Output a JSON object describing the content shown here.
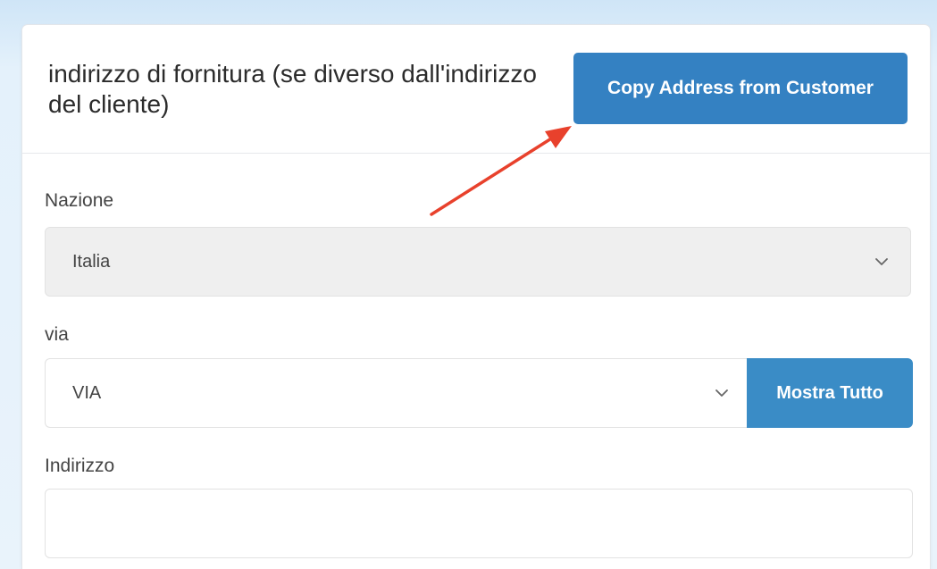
{
  "header": {
    "title": "indirizzo di fornitura (se diverso dall'indirizzo del cliente)",
    "copy_button_label": "Copy Address from Customer"
  },
  "fields": {
    "nazione": {
      "label": "Nazione",
      "selected_value": "Italia"
    },
    "via": {
      "label": "via",
      "selected_value": "VIA",
      "show_all_label": "Mostra Tutto"
    },
    "indirizzo": {
      "label": "Indirizzo",
      "value": "",
      "placeholder": ""
    }
  },
  "icons": {
    "select_chevron": "chevron-down-icon",
    "annotation": "red-arrow-icon"
  },
  "colors": {
    "primary_button": "#3481c2",
    "secondary_button": "#3a8cc6",
    "annotation_arrow": "#e8412c",
    "background": "#d6e9f8"
  }
}
